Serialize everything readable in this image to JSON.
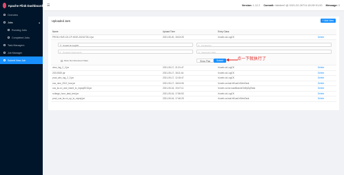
{
  "app": {
    "title": "Apache Flink Dashboard"
  },
  "sidebar": {
    "items": [
      {
        "label": "Overview",
        "icon": "overview-icon"
      },
      {
        "label": "Jobs",
        "icon": "jobs-icon"
      },
      {
        "label": "Running Jobs",
        "icon": "running-icon"
      },
      {
        "label": "Completed Jobs",
        "icon": "completed-icon"
      },
      {
        "label": "Task Managers",
        "icon": "task-manager-icon"
      },
      {
        "label": "Job Manager",
        "icon": "job-manager-icon"
      },
      {
        "label": "Submit New Job",
        "icon": "upload-icon"
      }
    ]
  },
  "header": {
    "version_label": "Version:",
    "version_value": "1.12.2",
    "commit_label": "Commit:",
    "commit_value": "4dedee0 @ 2021-02-26T11:18:26+01:00",
    "message_label": "Message:",
    "message_value": "0"
  },
  "card": {
    "title": "Uploaded Jars",
    "add_button": "+ Add New"
  },
  "table": {
    "headers": [
      "Name",
      "Upload Time",
      "Entry Class",
      ""
    ],
    "first_row": {
      "name": "PROD-HIVE-CK-CP-HIVE-20210726-V.jar",
      "time": "2021-05-20, 15:03:25",
      "entry": "hi.web.ck.LogCK",
      "action": "Delete"
    },
    "rows": [
      {
        "name": "view_log_2_2.jar",
        "time": "2021-05-17, 21:31:47",
        "entry": "hi.web.ck.LogCK",
        "action": "Delete"
      },
      {
        "name": "20210520.jar",
        "time": "2021-05-17, 18:11:44",
        "entry": "hi.web.ck.LogCK",
        "action": "Delete"
      },
      {
        "name": "prod_abc_log_2_3.jar",
        "time": "2021-05-17, 12:18:47",
        "entry": "hi.web.ck.LogCK",
        "action": "Delete"
      },
      {
        "name": "cus_new_2012_bus.jar",
        "time": "2021-05-17, 18:04:06",
        "entry": "hi.web.cs.bak.hiKuaCnSetsTask",
        "action": "Delete"
      },
      {
        "name": "cus_ku.cn_and_insert_to_mysql2016.jar",
        "time": "2021-05-16, 19:47:11",
        "entry": "hi.web.cs.bxr.iuanBrandsToMySqlTask",
        "action": "Delete"
      },
      {
        "name": "ru/large_hour_task_test.jar",
        "time": "2021-05-16, 17:56:53",
        "entry": "hi.web.ck.LogCK",
        "action": "Delete"
      },
      {
        "name": "prod_cus_ku.cn_up_to_mysql.jar",
        "time": "2021-05-16, 17:46:25",
        "entry": "hi.web.cs.bak.hiKuaCnSetsTask",
        "action": "Delete"
      }
    ]
  },
  "form": {
    "entry_class_value": "hi.web.ck.LogCK",
    "parallelism_placeholder": "Parallelism",
    "program_args_placeholder": "Program Arguments",
    "savepoint_placeholder": "Savepoint Path",
    "allow_non_restored_label": "Allow Non Restored State",
    "show_plan_label": "Show Plan",
    "submit_label": "Submit"
  },
  "annotation": {
    "text": "点一下就执行了",
    "color": "#e0201c"
  },
  "colors": {
    "accent": "#1890ff",
    "sidebar_bg": "#001529"
  }
}
